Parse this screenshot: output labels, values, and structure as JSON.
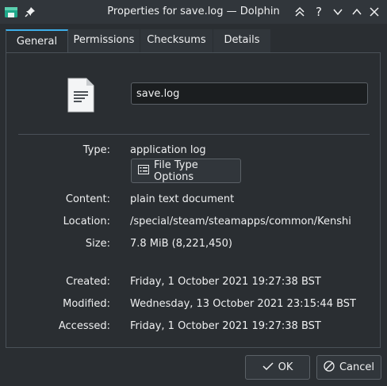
{
  "window": {
    "title": "Properties for save.log — Dolphin",
    "app_icon": "dolphin-icon",
    "pin_icon": "pin-icon",
    "controls": [
      "keep-above-icon",
      "help-icon",
      "minimize-icon",
      "maximize-icon",
      "close-icon"
    ]
  },
  "tabs": [
    {
      "label": "General",
      "active": true
    },
    {
      "label": "Permissions",
      "active": false
    },
    {
      "label": "Checksums",
      "active": false
    },
    {
      "label": "Details",
      "active": false
    }
  ],
  "general": {
    "file_icon": "text-document-icon",
    "filename": "save.log",
    "type_label": "Type:",
    "type_value": "application log",
    "file_type_options_label": "File Type Options",
    "content_label": "Content:",
    "content_value": "plain text document",
    "location_label": "Location:",
    "location_value": "/special/steam/steamapps/common/Kenshi",
    "size_label": "Size:",
    "size_value": "7.8 MiB (8,221,450)",
    "created_label": "Created:",
    "created_value": "Friday, 1 October 2021 19:27:38 BST",
    "modified_label": "Modified:",
    "modified_value": "Wednesday, 13 October 2021 23:15:44 BST",
    "accessed_label": "Accessed:",
    "accessed_value": "Friday, 1 October 2021 19:27:38 BST"
  },
  "buttons": {
    "ok_label": "OK",
    "cancel_label": "Cancel"
  },
  "colors": {
    "background": "#2a2e32",
    "titlebar": "#31363b",
    "accent": "#3daee9",
    "text": "#eff0f1"
  }
}
